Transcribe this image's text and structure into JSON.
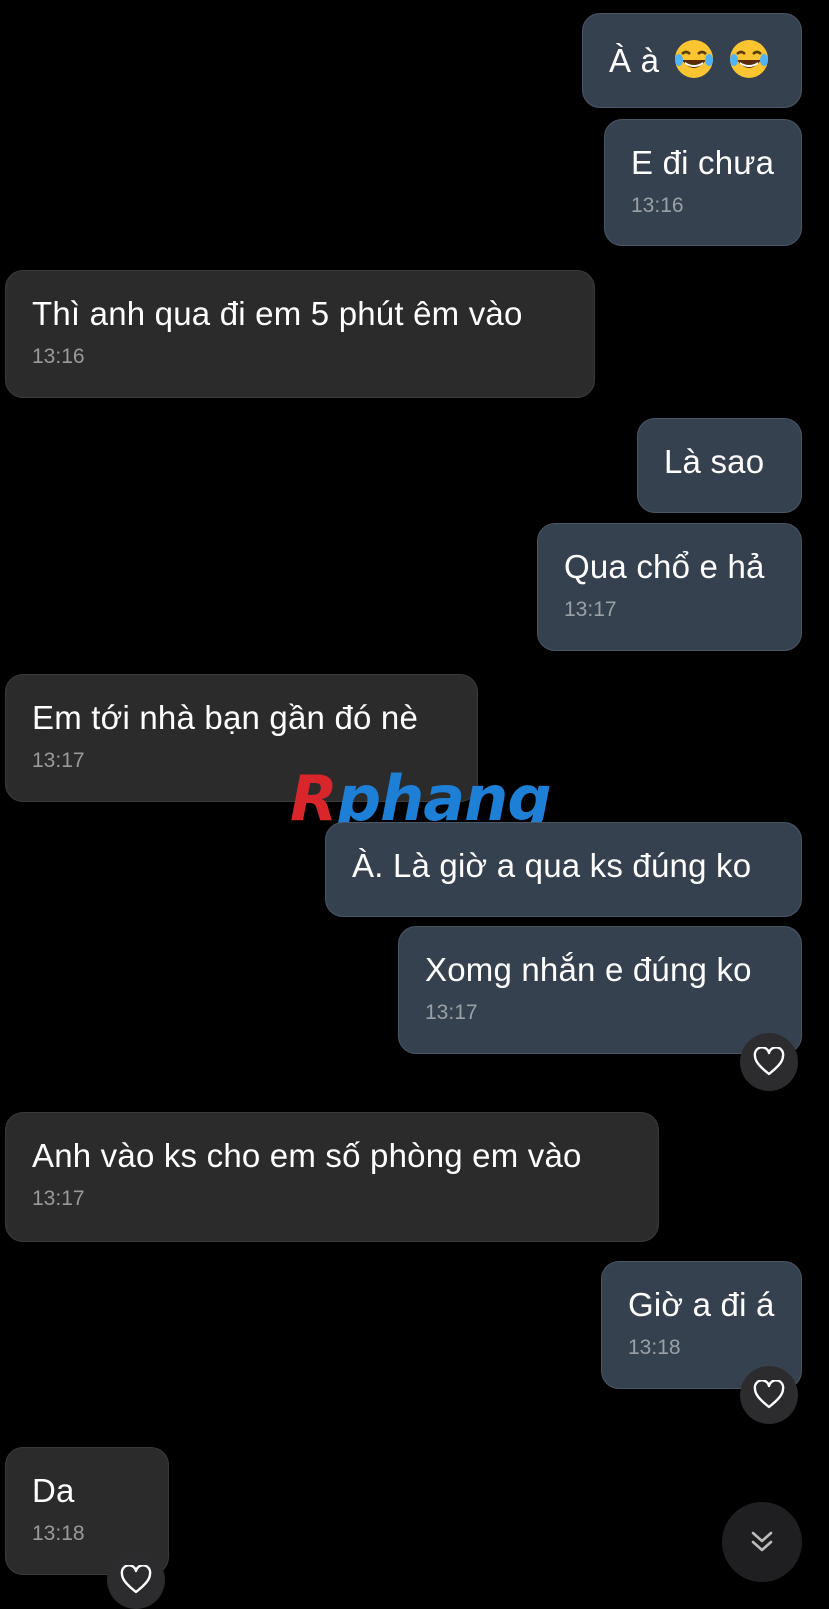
{
  "messages": [
    {
      "dir": "out",
      "text": "À à",
      "emoji": [
        "laughing-tears",
        "laughing-tears"
      ],
      "time": ""
    },
    {
      "dir": "out",
      "text": "E đi chưa",
      "time": "13:16"
    },
    {
      "dir": "in",
      "text": "Thì anh qua đi em 5 phút êm vào",
      "time": "13:16"
    },
    {
      "dir": "out",
      "text": "Là sao",
      "time": ""
    },
    {
      "dir": "out",
      "text": "Qua chổ e hả",
      "time": "13:17"
    },
    {
      "dir": "in",
      "text": "Em tới nhà bạn gần đó nè",
      "time": "13:17"
    },
    {
      "dir": "out",
      "text": "À. Là giờ a qua ks đúng ko",
      "time": ""
    },
    {
      "dir": "out",
      "text": "Xomg nhắn e đúng ko",
      "time": "13:17"
    },
    {
      "dir": "in",
      "text": "Anh vào ks cho em số phòng em vào",
      "time": "13:17"
    },
    {
      "dir": "out",
      "text": "Giờ a đi á",
      "time": "13:18"
    },
    {
      "dir": "in",
      "text": "Da",
      "time": "13:18"
    }
  ],
  "watermark": {
    "part1": "R",
    "part2": "phang"
  },
  "colors": {
    "background": "#000000",
    "outgoing_bubble": "#36414f",
    "incoming_bubble": "#2b2b2b",
    "time_text": "#9aa0a6"
  },
  "icons": {
    "reaction": "heart-outline-icon",
    "scroll_down": "double-chevron-down-icon"
  }
}
